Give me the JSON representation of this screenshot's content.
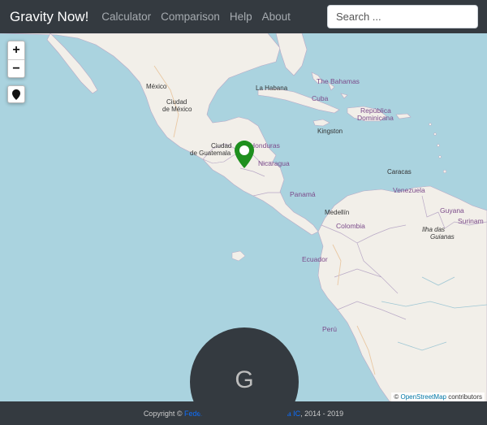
{
  "navbar": {
    "brand": "Gravity Now!",
    "links": [
      "Calculator",
      "Comparison",
      "Help",
      "About"
    ],
    "search_placeholder": "Search ..."
  },
  "map": {
    "zoom_in": "+",
    "zoom_out": "−",
    "labels": {
      "mexico": "México",
      "ciudad_de_mexico_1": "Ciudad",
      "ciudad_de_mexico_2": "de México",
      "la_habana": "La Habana",
      "bahamas": "The Bahamas",
      "cuba": "Cuba",
      "republica_1": "República",
      "republica_2": "Dominicana",
      "kingston": "Kingston",
      "ciudad_guatemala_1": "Ciudad",
      "ciudad_guatemala_2": "de Guatemala",
      "honduras": "Honduras",
      "nicaragua": "Nicaragua",
      "caracas": "Caracas",
      "panama": "Panamá",
      "venezuela": "Venezuela",
      "medellin": "Medellín",
      "guyana": "Guyana",
      "surinam": "Surinam",
      "colombia": "Colombia",
      "ilha_1": "Ilha das",
      "ilha_2": "Guianas",
      "ecuador": "Ecuador",
      "peru": "Perú"
    },
    "attribution_prefix": "©",
    "attribution_link": "OpenStreetMap",
    "attribution_suffix": "contributors",
    "colors": {
      "water": "#aad3df",
      "land": "#f2efe9",
      "marker": "#1e8f1e"
    }
  },
  "badge": {
    "letter": "G"
  },
  "footer": {
    "prefix": "Copyright ©",
    "author1": "Federico Navarrete",
    "amp": "&",
    "author2": "Supernova IC",
    "years": ", 2014 - 2019"
  }
}
